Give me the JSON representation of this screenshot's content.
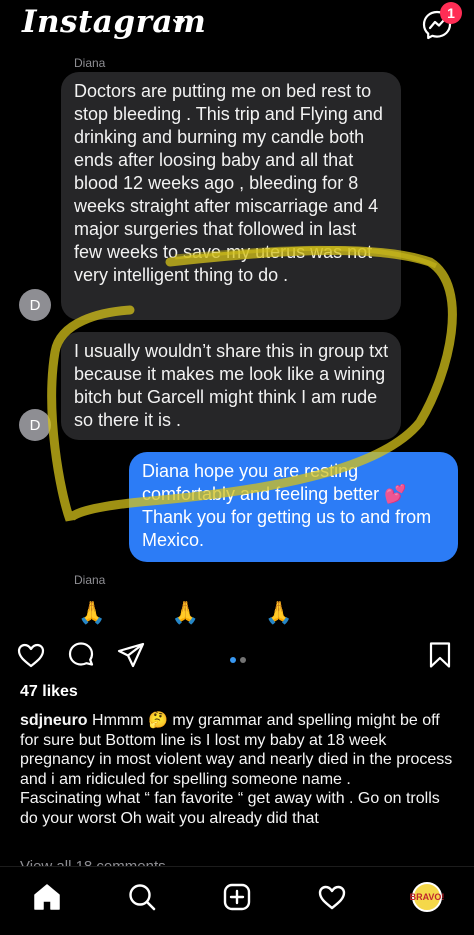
{
  "header": {
    "app_name": "Instagram",
    "notification_count": "1"
  },
  "post": {
    "messages": [
      {
        "sender": "Diana",
        "avatar": "D",
        "text": "Doctors are putting me on bed rest to stop bleeding . This trip and Flying and drinking and burning my candle both ends after loosing baby and all that blood 12 weeks ago , bleeding for 8 weeks straight after miscarriage and 4 major surgeries that followed in last few weeks to save my uterus was not very intelligent thing to do ."
      },
      {
        "sender": "",
        "avatar": "D",
        "text": "I usually wouldn’t share this in group txt because it makes me look like a wining bitch but Garcell might think I am rude so there it is ."
      },
      {
        "sender": "me",
        "text": "Diana hope you are resting comfortably and feeling better 💕 Thank you for getting us to and from Mexico."
      },
      {
        "sender": "Diana",
        "text": "🙏 🙏 🙏"
      }
    ],
    "highlight_color": "#d4c11a"
  },
  "actions": {
    "like_icon": "heart-icon",
    "comment_icon": "comment-icon",
    "share_icon": "send-icon",
    "save_icon": "bookmark-icon",
    "carousel_active_color": "#3897f0"
  },
  "likes": "47 likes",
  "caption": {
    "username": "sdjneuro",
    "text": "Hmmm 🤔 my grammar and spelling might be off for sure  but Bottom line is I lost my baby at 18 week pregnancy in most violent way and nearly died in the process and i am ridiculed for spelling someone name .",
    "text2": "Fascinating what “ fan favorite “ get away with .  Go on trolls do your worst Oh wait you already did that"
  },
  "view_comments": "View all 18 comments",
  "nav": {
    "items": [
      "home-icon",
      "search-icon",
      "new-post-icon",
      "activity-icon",
      "profile-avatar"
    ],
    "profile_text": "BRAVO!"
  }
}
